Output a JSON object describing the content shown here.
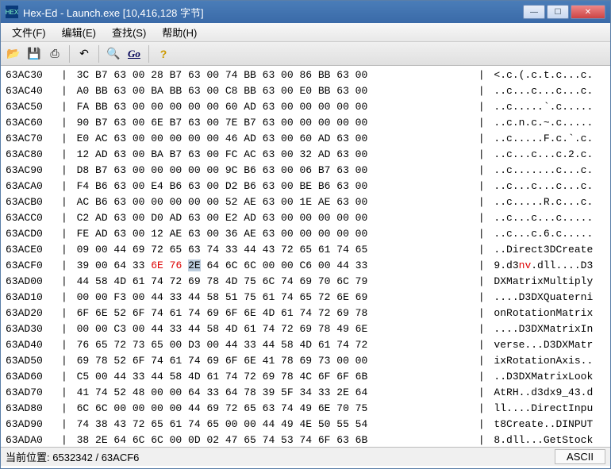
{
  "window": {
    "app_icon_text": "HEX",
    "title": "Hex-Ed - Launch.exe [10,416,128 字节]"
  },
  "menubar": {
    "file": "文件(F)",
    "edit": "编辑(E)",
    "find": "查找(S)",
    "help": "帮助(H)"
  },
  "toolbar": {
    "open_icon": "📂",
    "save_icon": "💾",
    "save2_icon": "⎙",
    "undo_icon": "↶",
    "search_icon": "🔍",
    "go_label": "Go",
    "help_icon": "?"
  },
  "hex": {
    "rows": [
      {
        "addr": "63AC30",
        "bytes": "3C B7 63 00 28 B7 63 00 74 BB 63 00 86 BB 63 00",
        "ascii": "<.c.(.c.t.c...c."
      },
      {
        "addr": "63AC40",
        "bytes": "A0 BB 63 00 BA BB 63 00 C8 BB 63 00 E0 BB 63 00",
        "ascii": "..c...c...c...c."
      },
      {
        "addr": "63AC50",
        "bytes": "FA BB 63 00 00 00 00 00 60 AD 63 00 00 00 00 00",
        "ascii": "..c.....`.c....."
      },
      {
        "addr": "63AC60",
        "bytes": "90 B7 63 00 6E B7 63 00 7E B7 63 00 00 00 00 00",
        "ascii": "..c.n.c.~.c....."
      },
      {
        "addr": "63AC70",
        "bytes": "E0 AC 63 00 00 00 00 00 46 AD 63 00 60 AD 63 00",
        "ascii": "..c.....F.c.`.c."
      },
      {
        "addr": "63AC80",
        "bytes": "12 AD 63 00 BA B7 63 00 FC AC 63 00 32 AD 63 00",
        "ascii": "..c...c...c.2.c."
      },
      {
        "addr": "63AC90",
        "bytes": "D8 B7 63 00 00 00 00 00 9C B6 63 00 06 B7 63 00",
        "ascii": "..c.......c...c."
      },
      {
        "addr": "63ACA0",
        "bytes": "F4 B6 63 00 E4 B6 63 00 D2 B6 63 00 BE B6 63 00",
        "ascii": "..c...c...c...c."
      },
      {
        "addr": "63ACB0",
        "bytes": "AC B6 63 00 00 00 00 00 52 AE 63 00 1E AE 63 00",
        "ascii": "..c.....R.c...c."
      },
      {
        "addr": "63ACC0",
        "bytes": "C2 AD 63 00 D0 AD 63 00 E2 AD 63 00 00 00 00 00",
        "ascii": "..c...c...c....."
      },
      {
        "addr": "63ACD0",
        "bytes": "FE AD 63 00 12 AE 63 00 36 AE 63 00 00 00 00 00",
        "ascii": "..c...c.6.c....."
      },
      {
        "addr": "63ACE0",
        "bytes": "09 00 44 69 72 65 63 74 33 44 43 72 65 61 74 65",
        "ascii": "..Direct3DCreate"
      },
      {
        "addr": "63ACF0",
        "bytes": "39 00 64 33 6E 76 2E 64 6C 6C 00 00 C6 00 44 33",
        "ascii": "9.d3nv.dll....D3",
        "hl": [
          {
            "start": 4,
            "end": 5,
            "class": "hl-red"
          },
          {
            "start": 6,
            "end": 6,
            "class": "hl-sel"
          }
        ]
      },
      {
        "addr": "63AD00",
        "bytes": "44 58 4D 61 74 72 69 78 4D 75 6C 74 69 70 6C 79",
        "ascii": "DXMatrixMultiply"
      },
      {
        "addr": "63AD10",
        "bytes": "00 00 F3 00 44 33 44 58 51 75 61 74 65 72 6E 69",
        "ascii": "....D3DXQuaterni"
      },
      {
        "addr": "63AD20",
        "bytes": "6F 6E 52 6F 74 61 74 69 6F 6E 4D 61 74 72 69 78",
        "ascii": "onRotationMatrix"
      },
      {
        "addr": "63AD30",
        "bytes": "00 00 C3 00 44 33 44 58 4D 61 74 72 69 78 49 6E",
        "ascii": "....D3DXMatrixIn"
      },
      {
        "addr": "63AD40",
        "bytes": "76 65 72 73 65 00 D3 00 44 33 44 58 4D 61 74 72",
        "ascii": "verse...D3DXMatr"
      },
      {
        "addr": "63AD50",
        "bytes": "69 78 52 6F 74 61 74 69 6F 6E 41 78 69 73 00 00",
        "ascii": "ixRotationAxis.."
      },
      {
        "addr": "63AD60",
        "bytes": "C5 00 44 33 44 58 4D 61 74 72 69 78 4C 6F 6F 6B",
        "ascii": "..D3DXMatrixLook"
      },
      {
        "addr": "63AD70",
        "bytes": "41 74 52 48 00 00 64 33 64 78 39 5F 34 33 2E 64",
        "ascii": "AtRH..d3dx9_43.d"
      },
      {
        "addr": "63AD80",
        "bytes": "6C 6C 00 00 00 00 44 69 72 65 63 74 49 6E 70 75",
        "ascii": "ll....DirectInpu"
      },
      {
        "addr": "63AD90",
        "bytes": "74 38 43 72 65 61 74 65 00 00 44 49 4E 50 55 54",
        "ascii": "t8Create..DINPUT"
      },
      {
        "addr": "63ADA0",
        "bytes": "38 2E 64 6C 6C 00 0D 02 47 65 74 53 74 6F 63 6B",
        "ascii": "8.dll...GetStock"
      }
    ]
  },
  "statusbar": {
    "position_label": "当前位置:",
    "position_value": "6532342 / 63ACF6",
    "mode": "ASCII"
  }
}
